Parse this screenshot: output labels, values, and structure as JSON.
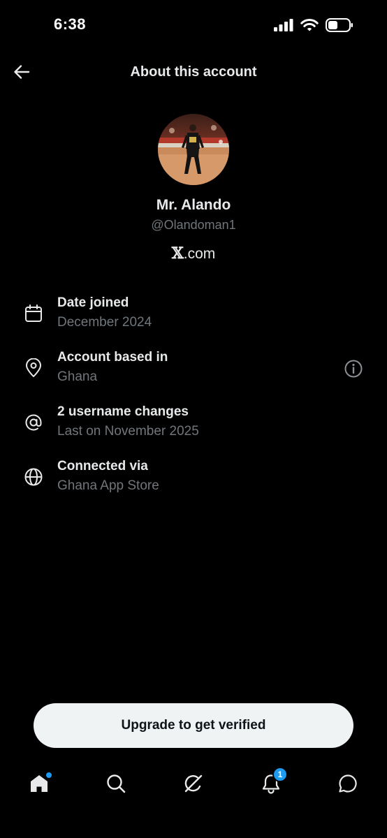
{
  "status_bar": {
    "time": "6:38",
    "icons": [
      "signal-icon",
      "wifi-icon",
      "battery-icon"
    ]
  },
  "header": {
    "title": "About this account",
    "back_icon": "arrow-left-icon"
  },
  "profile": {
    "name": "Mr. Alando",
    "handle": "@Olandoman1",
    "site_mark": "𝕏",
    "site_suffix": ".com"
  },
  "info_rows": [
    {
      "icon": "calendar-icon",
      "title": "Date joined",
      "subtitle": "December 2024"
    },
    {
      "icon": "location-pin-icon",
      "title": "Account based in",
      "subtitle": "Ghana",
      "extra_icon": "info-icon"
    },
    {
      "icon": "at-sign-icon",
      "title": "2 username changes",
      "subtitle": "Last on November 2025"
    },
    {
      "icon": "globe-icon",
      "title": "Connected via",
      "subtitle": "Ghana App Store"
    }
  ],
  "upgrade": {
    "label": "Upgrade to get verified"
  },
  "bottom_nav": {
    "items": [
      "home-icon",
      "search-icon",
      "grok-icon",
      "bell-icon",
      "messages-icon"
    ],
    "notifications_badge": "1"
  },
  "colors": {
    "background": "#000000",
    "primary_text": "#e7e9ea",
    "secondary_text": "#71767b",
    "accent": "#1d9bf0",
    "button_bg": "#eff3f4"
  }
}
